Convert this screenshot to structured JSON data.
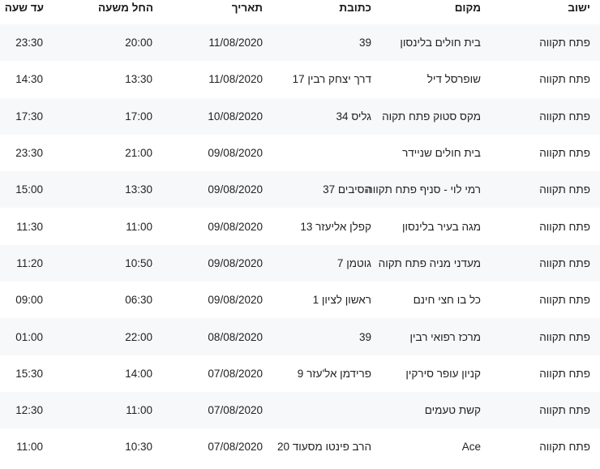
{
  "headers": {
    "city": "ישוב",
    "place": "מקום",
    "address": "כתובת",
    "date": "תאריך",
    "from": "החל משעה",
    "to": "עד שעה"
  },
  "rows": [
    {
      "city": "פתח תקווה",
      "place": "בית חולים בלינסון",
      "address": "39",
      "date": "11/08/2020",
      "from": "20:00",
      "to": "23:30"
    },
    {
      "city": "פתח תקווה",
      "place": "שופרסל דיל",
      "address": "דרך יצחק רבין 17",
      "date": "11/08/2020",
      "from": "13:30",
      "to": "14:30"
    },
    {
      "city": "פתח תקווה",
      "place": "מקס סטוק פתח תקוה",
      "address": "גליס 34",
      "date": "10/08/2020",
      "from": "17:00",
      "to": "17:30"
    },
    {
      "city": "פתח תקווה",
      "place": "בית חולים שניידר",
      "address": "",
      "date": "09/08/2020",
      "from": "21:00",
      "to": "23:30"
    },
    {
      "city": "פתח תקווה",
      "place": "רמי לוי - סניף פתח תקווה",
      "address": "הסיבים 37",
      "date": "09/08/2020",
      "from": "13:30",
      "to": "15:00"
    },
    {
      "city": "פתח תקווה",
      "place": "מגה בעיר בלינסון",
      "address": "קפלן אליעזר 13",
      "date": "09/08/2020",
      "from": "11:00",
      "to": "11:30"
    },
    {
      "city": "פתח תקווה",
      "place": "מעדני מניה פתח תקוה",
      "address": "גוטמן 7",
      "date": "09/08/2020",
      "from": "10:50",
      "to": "11:20"
    },
    {
      "city": "פתח תקווה",
      "place": "כל בו חצי חינם",
      "address": "ראשון לציון 1",
      "date": "09/08/2020",
      "from": "06:30",
      "to": "09:00"
    },
    {
      "city": "פתח תקווה",
      "place": "מרכז רפואי רבין",
      "address": "39",
      "date": "08/08/2020",
      "from": "22:00",
      "to": "01:00"
    },
    {
      "city": "פתח תקווה",
      "place": "קניון עופר סירקין",
      "address": "פרידמן אל'עזר 9",
      "date": "07/08/2020",
      "from": "14:00",
      "to": "15:30"
    },
    {
      "city": "פתח תקווה",
      "place": "קשת טעמים",
      "address": "",
      "date": "07/08/2020",
      "from": "11:00",
      "to": "12:30"
    },
    {
      "city": "פתח תקווה",
      "place": "Ace",
      "address": "הרב פינטו מסעוד 20",
      "date": "07/08/2020",
      "from": "10:30",
      "to": "11:00"
    }
  ]
}
